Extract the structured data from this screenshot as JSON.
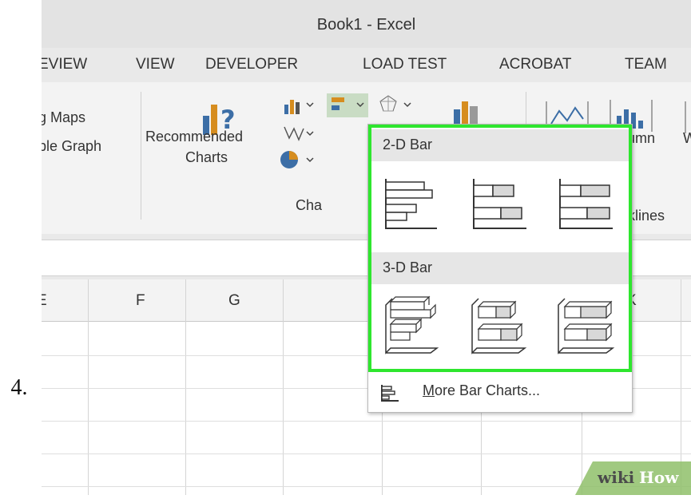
{
  "step_number": "4.",
  "window": {
    "title": "Book1 - Excel"
  },
  "tabs": [
    "EVIEW",
    "VIEW",
    "DEVELOPER",
    "LOAD TEST",
    "ACROBAT",
    "TEAM"
  ],
  "ribbon": {
    "maps_label": "g Maps",
    "graph_label": "ple Graph",
    "recommended_line1": "Recommended",
    "recommended_line2": "Charts",
    "charts_group": "Cha",
    "column_label": "Column",
    "w_label": "W",
    "sparklines_group": "Sparklines"
  },
  "columns": [
    "E",
    "F",
    "G",
    "K"
  ],
  "dropdown": {
    "section_2d": "2-D Bar",
    "section_3d": "3-D Bar",
    "more_prefix": "M",
    "more_rest": "ore Bar Charts..."
  },
  "watermark": {
    "part1": "wiki",
    "part2": "How"
  },
  "colors": {
    "highlight": "#2ee62e",
    "excel_green": "#217346"
  }
}
